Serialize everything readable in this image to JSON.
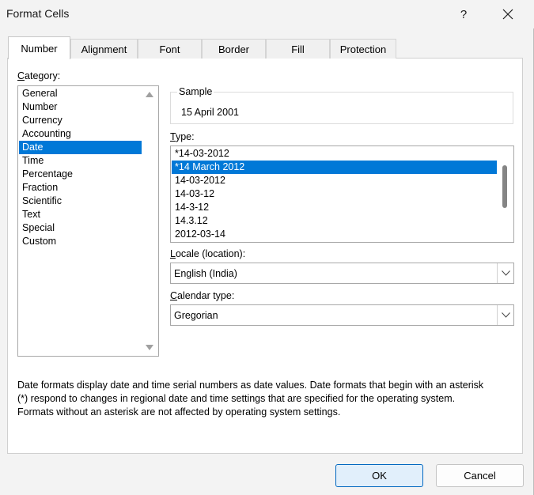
{
  "window": {
    "title": "Format Cells",
    "help_label": "?"
  },
  "tabs": [
    {
      "label": "Number",
      "active": true
    },
    {
      "label": "Alignment",
      "active": false
    },
    {
      "label": "Font",
      "active": false
    },
    {
      "label": "Border",
      "active": false
    },
    {
      "label": "Fill",
      "active": false
    },
    {
      "label": "Protection",
      "active": false
    }
  ],
  "category": {
    "label_first": "C",
    "label_rest": "ategory:",
    "items": [
      "General",
      "Number",
      "Currency",
      "Accounting",
      "Date",
      "Time",
      "Percentage",
      "Fraction",
      "Scientific",
      "Text",
      "Special",
      "Custom"
    ],
    "selected": "Date"
  },
  "sample": {
    "legend": "Sample",
    "value": "15 April 2001"
  },
  "type": {
    "label_first": "T",
    "label_rest": "ype:",
    "items": [
      "*14-03-2012",
      "*14 March 2012",
      "14-03-2012",
      "14-03-12",
      "14-3-12",
      "14.3.12",
      "2012-03-14"
    ],
    "selected": "*14 March 2012"
  },
  "locale": {
    "label_first": "L",
    "label_rest": "ocale (location):",
    "value": "English (India)"
  },
  "calendar": {
    "label_first": "C",
    "label_rest": "alendar type:",
    "value": "Gregorian"
  },
  "description": {
    "line1": "Date formats display date and time serial numbers as date values.  Date formats that begin with an asterisk",
    "line2": "(*) respond to changes in regional date and time settings that are specified for the operating system.",
    "line3": "Formats without an asterisk are not affected by operating system settings."
  },
  "buttons": {
    "ok": "OK",
    "cancel": "Cancel"
  },
  "colors": {
    "selection": "#0078d7",
    "ok_border": "#0067c0"
  }
}
